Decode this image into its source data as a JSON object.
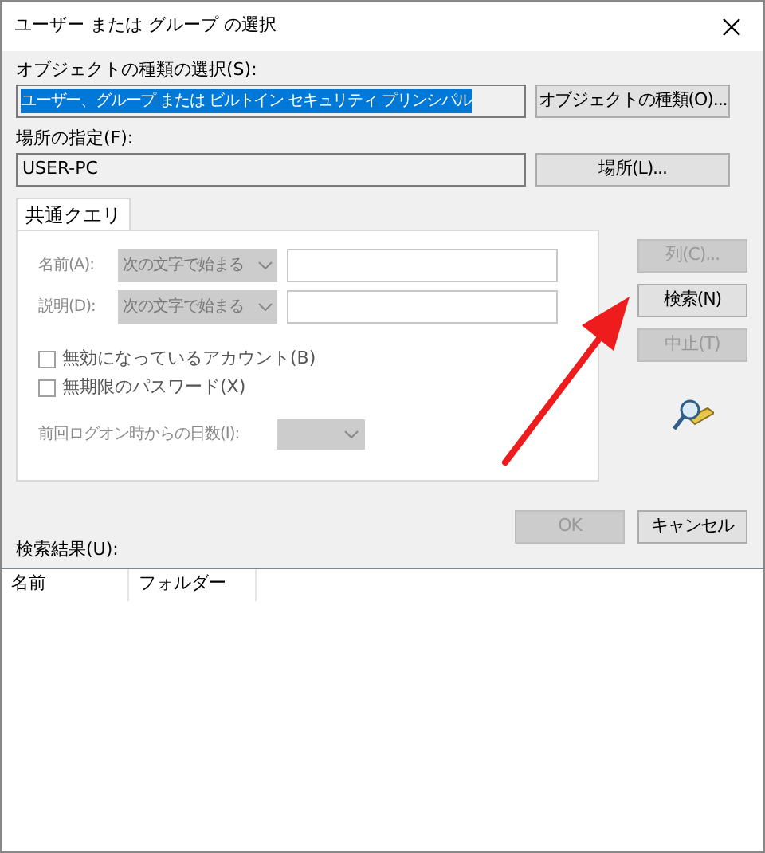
{
  "window": {
    "title": "ユーザー または グループ の選択"
  },
  "object_types": {
    "label": "オブジェクトの種類の選択(S):",
    "value": "ユーザー、グループ または ビルトイン セキュリティ プリンシパル",
    "value_selected": true,
    "button": "オブジェクトの種類(O)..."
  },
  "location": {
    "label": "場所の指定(F):",
    "value": "USER-PC",
    "button": "場所(L)..."
  },
  "tabs": [
    {
      "label": "共通クエリ",
      "selected": true
    }
  ],
  "query": {
    "filters": [
      {
        "label": "名前(A):",
        "match": "次の文字で始まる",
        "disabled": true
      },
      {
        "label": "説明(D):",
        "match": "次の文字で始まる",
        "disabled": true
      }
    ],
    "checkboxes": [
      {
        "label": "無効になっているアカウント(B)",
        "checked": false
      },
      {
        "label": "無期限のパスワード(X)",
        "checked": false
      }
    ],
    "days": {
      "label": "前回ログオン時からの日数(I):",
      "disabled": true
    }
  },
  "side_buttons": [
    {
      "label": "列(C)...",
      "disabled": true
    },
    {
      "label": "検索(N)",
      "disabled": false
    },
    {
      "label": "中止(T)",
      "disabled": true
    }
  ],
  "dialog_buttons": [
    {
      "label": "OK",
      "disabled": true
    },
    {
      "label": "キャンセル",
      "disabled": false
    }
  ],
  "results": {
    "label": "検索結果(U):",
    "columns": [
      "名前",
      "フォルダー"
    ]
  }
}
